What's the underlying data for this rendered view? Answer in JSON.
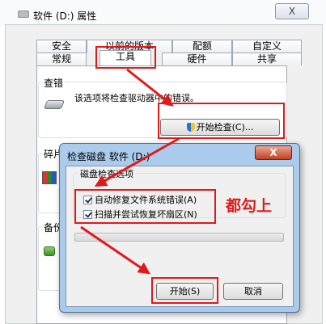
{
  "window": {
    "title": "软件 (D:) 属性",
    "close_label": "X"
  },
  "tabs": {
    "row1": [
      "安全",
      "以前的版本",
      "配额",
      "自定义"
    ],
    "row2": [
      "常规",
      "工具",
      "硬件",
      "共享"
    ],
    "active": "工具"
  },
  "error_checking": {
    "group_label": "查错",
    "description": "该选项将检查驱动器中的错误。",
    "button_label": "开始检查(C)..."
  },
  "defrag": {
    "group_label": "碎片"
  },
  "backup": {
    "group_label": "备份"
  },
  "check_disk_dialog": {
    "title": "检查磁盘 软件 (D:)",
    "close_label": "X",
    "options_label": "磁盘检查选项",
    "options": [
      {
        "label": "自动修复文件系统错误(A)",
        "checked": true
      },
      {
        "label": "扫描并尝试恢复坏扇区(N)",
        "checked": true
      }
    ],
    "progress": 0,
    "start_button": "开始(S)",
    "cancel_button": "取消"
  },
  "annotation": {
    "note": "都勾上",
    "color": "#e01a1a"
  }
}
